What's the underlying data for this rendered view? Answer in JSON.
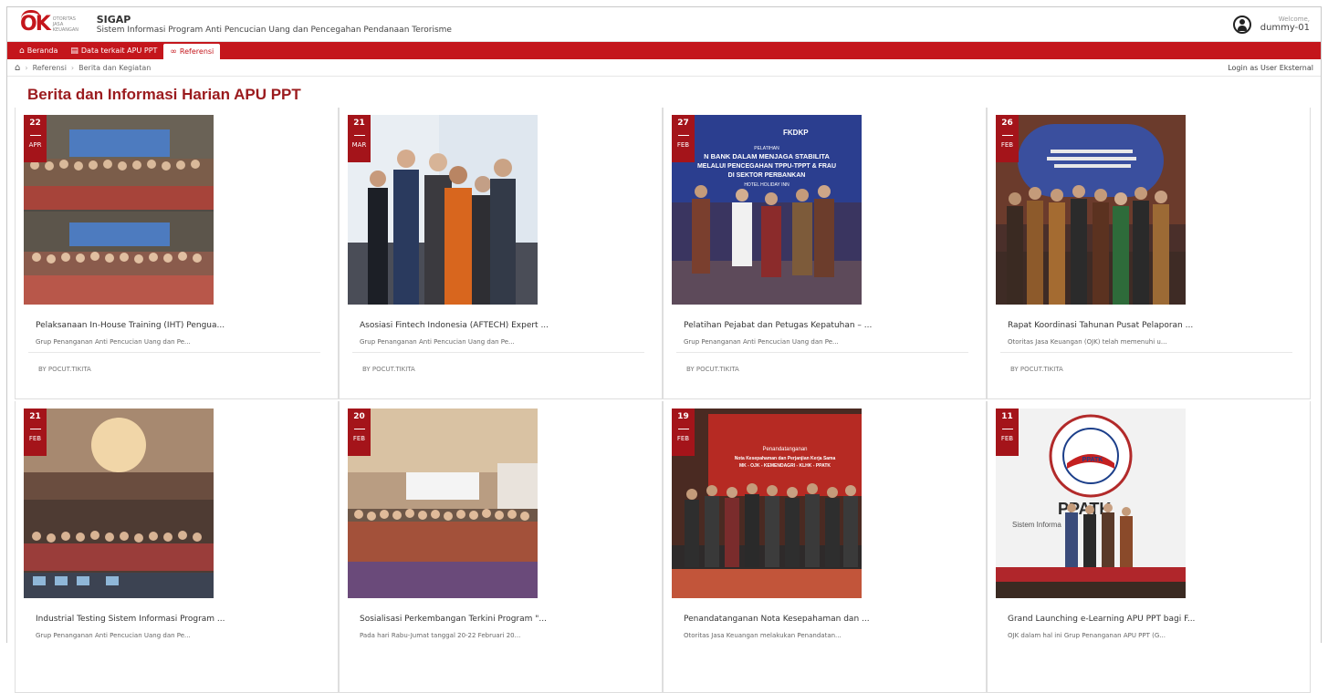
{
  "header": {
    "logo_text": "OK",
    "logo_caption": "Otoritas Jasa Keuangan",
    "app_title": "SIGAP",
    "app_subtitle": "Sistem Informasi Program Anti Pencucian Uang dan Pencegahan Pendanaan Terorisme",
    "welcome": "Welcome,",
    "username": "dummy-01",
    "user_icon": "user-circle-icon"
  },
  "nav": {
    "items": [
      {
        "label": "Beranda",
        "icon": "home-icon"
      },
      {
        "label": "Data terkait APU PPT",
        "icon": "book-icon"
      },
      {
        "label": "Referensi",
        "icon": "link-icon"
      }
    ],
    "active_index": 2
  },
  "breadcrumb": {
    "home_icon": "home-icon",
    "items": [
      "Referensi",
      "Berita dan Kegiatan"
    ],
    "login_link": "Login as User Eksternal"
  },
  "page_title": "Berita dan Informasi Harian APU PPT",
  "colors": {
    "brand": "#c4161c",
    "title": "#9b1b1e",
    "date_tab": "#a4141a"
  },
  "cards": [
    {
      "day": "22",
      "month": "APR",
      "title": "Pelaksanaan In-House Training (IHT) Pengua...",
      "desc": "Grup Penanganan Anti Pencucian Uang dan Pe...",
      "author": "BY POCUT.TIKITA"
    },
    {
      "day": "21",
      "month": "MAR",
      "title": "Asosiasi Fintech Indonesia (AFTECH) Expert ...",
      "desc": "Grup Penanganan Anti Pencucian Uang dan Pe...",
      "author": "BY POCUT.TIKITA"
    },
    {
      "day": "27",
      "month": "FEB",
      "title": "Pelatihan Pejabat dan Petugas Kepatuhan – ...",
      "desc": "Grup Penanganan Anti Pencucian Uang dan Pe...",
      "author": "BY POCUT.TIKITA"
    },
    {
      "day": "26",
      "month": "FEB",
      "title": "Rapat Koordinasi Tahunan Pusat Pelaporan ...",
      "desc": "Otoritas Jasa Keuangan (OJK) telah memenuhi u...",
      "author": "BY POCUT.TIKITA"
    },
    {
      "day": "21",
      "month": "FEB",
      "title": "Industrial Testing Sistem Informasi Program ...",
      "desc": "Grup Penanganan Anti Pencucian Uang dan Pe...",
      "author": ""
    },
    {
      "day": "20",
      "month": "FEB",
      "title": "Sosialisasi Perkembangan Terkini Program \"...",
      "desc": "Pada hari Rabu-Jumat tanggal 20-22 Februari 20...",
      "author": ""
    },
    {
      "day": "19",
      "month": "FEB",
      "title": "Penandatanganan Nota Kesepahaman dan ...",
      "desc": "Otoritas Jasa Keuangan melakukan Penandatan...",
      "author": ""
    },
    {
      "day": "11",
      "month": "FEB",
      "title": "Grand Launching e-Learning APU PPT bagi F...",
      "desc": "OJK dalam hal ini Grup Penanganan APU PPT (G...",
      "author": ""
    }
  ],
  "photo_text": {
    "c3_banner_1": "FKDKP",
    "c3_banner_2": "PELATIHAN",
    "c3_banner_3": "N BANK DALAM MENJAGA STABILITA",
    "c3_banner_4": "MELALUI PENCEGAHAN TPPU-TPPT & FRAU",
    "c3_banner_5": "DI SEKTOR PERBANKAN",
    "c3_banner_6": "HOTEL HOLIDAY INN",
    "c7_banner_1": "Penandatanganan",
    "c7_banner_2": "Nota Kesepahaman dan Perjanjian Kerja Sama",
    "c7_banner_3": "MK - OJK - KEMENDAGRI - KLHK - PPATK",
    "c8_seal": "PPATK",
    "c8_screen_1": "PPATK",
    "c8_screen_2": "Sistem Informa"
  }
}
